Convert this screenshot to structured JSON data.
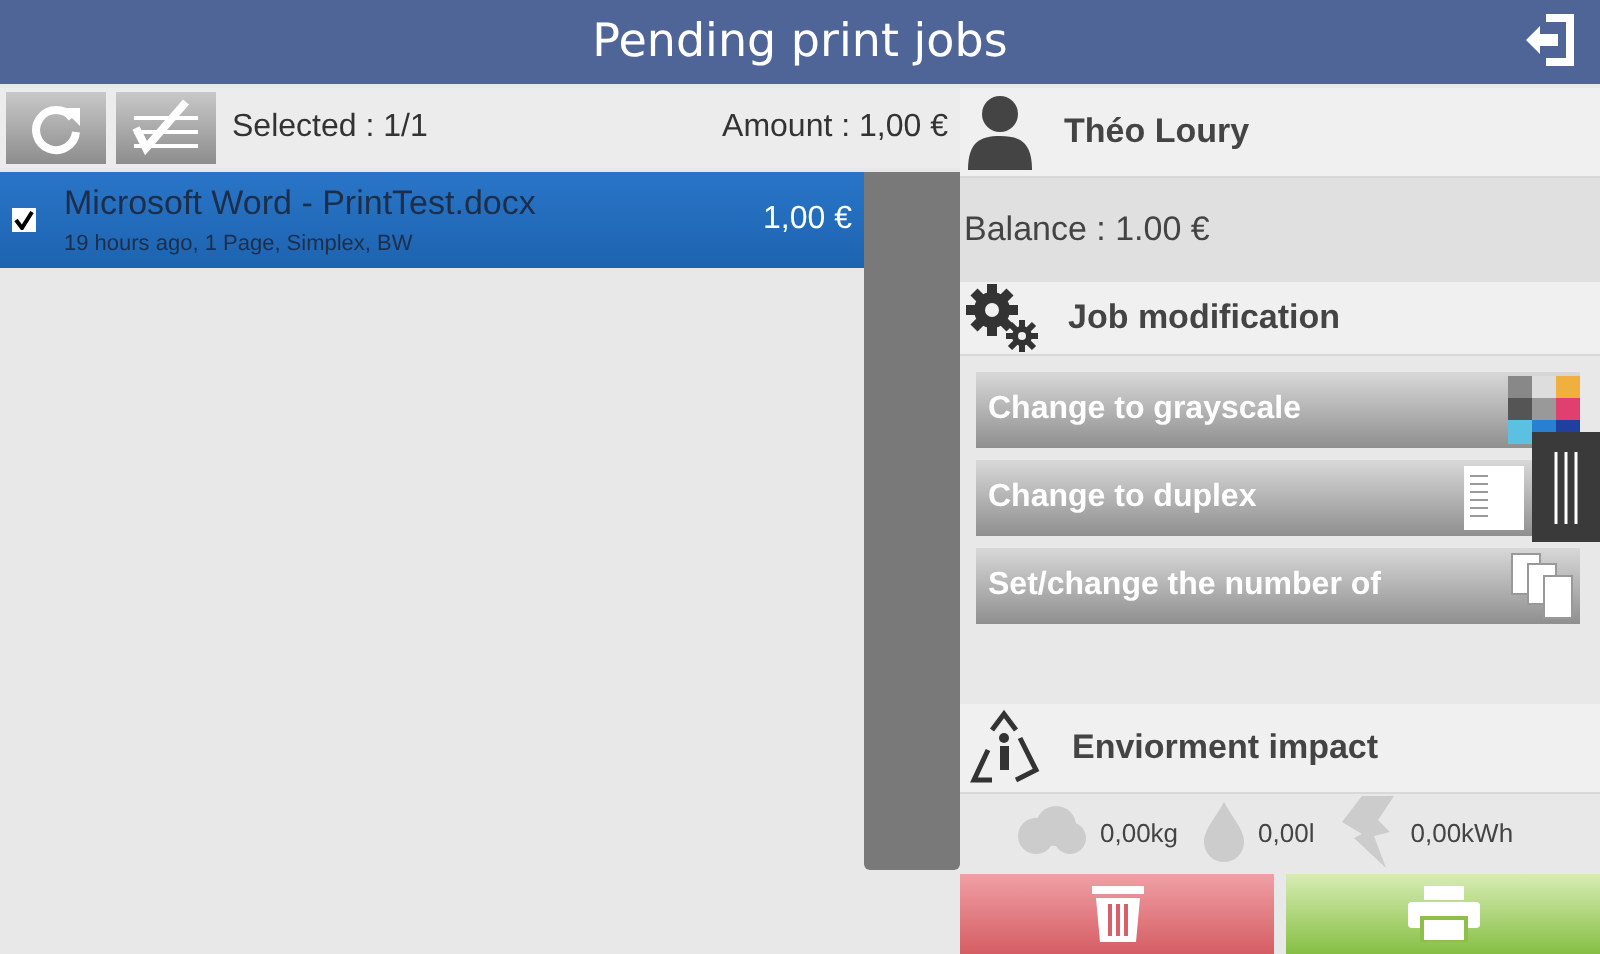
{
  "header": {
    "title": "Pending print jobs"
  },
  "toolbar": {
    "selected_text": "Selected : 1/1",
    "amount_text": "Amount : 1,00 €"
  },
  "jobs": [
    {
      "name": "Microsoft Word - PrintTest.docx",
      "details": "19 hours ago, 1 Page, Simplex, BW",
      "price": "1,00 €",
      "selected": true,
      "checked": true
    }
  ],
  "user": {
    "name": "Théo Loury",
    "balance": "Balance : 1.00 €"
  },
  "job_modification": {
    "title": "Job modification",
    "actions": [
      {
        "kind": "grayscale",
        "label": "Change to grayscale"
      },
      {
        "kind": "duplex",
        "label": "Change to duplex"
      },
      {
        "kind": "copies",
        "label": "Set/change the number of"
      }
    ]
  },
  "environment": {
    "title": "Enviorment impact",
    "metrics": [
      {
        "kind": "co2",
        "value": "0,00kg"
      },
      {
        "kind": "water",
        "value": "0,00l"
      },
      {
        "kind": "energy",
        "value": "0,00kWh"
      }
    ]
  }
}
